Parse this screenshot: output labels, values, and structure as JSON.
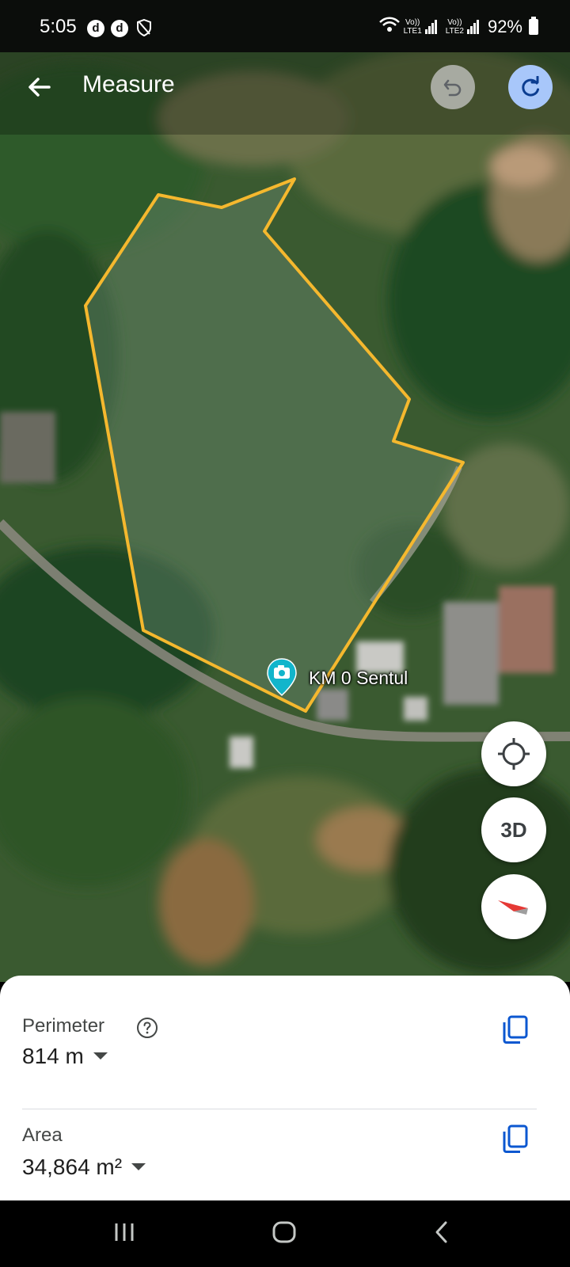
{
  "status_bar": {
    "time": "5:05",
    "notification_icons": [
      "d",
      "d"
    ],
    "shield_icon": "shield-icon",
    "sim1_label_top": "Vo))",
    "sim1_label_bottom": "LTE1",
    "sim2_label_top": "Vo))",
    "sim2_label_bottom": "LTE2",
    "battery": "92%"
  },
  "top_bar": {
    "title": "Measure",
    "back_icon": "arrow-left-icon",
    "undo_icon": "undo-icon",
    "redo_icon": "redo-icon"
  },
  "map": {
    "place_label": "KM 0 Sentul",
    "place_icon": "camera-pin-icon",
    "outline_color": "#f5b82e"
  },
  "map_controls": {
    "location_icon": "my-location-icon",
    "view_3d_label": "3D",
    "compass_icon": "compass-icon"
  },
  "measurements": {
    "perimeter_label": "Perimeter",
    "perimeter_value": "814 m",
    "area_label": "Area",
    "area_value": "34,864 m²",
    "copy_icon_color": "#0b57d0"
  },
  "nav_bar": {
    "recents_icon": "recents-icon",
    "home_icon": "home-icon",
    "back_icon": "back-icon"
  }
}
